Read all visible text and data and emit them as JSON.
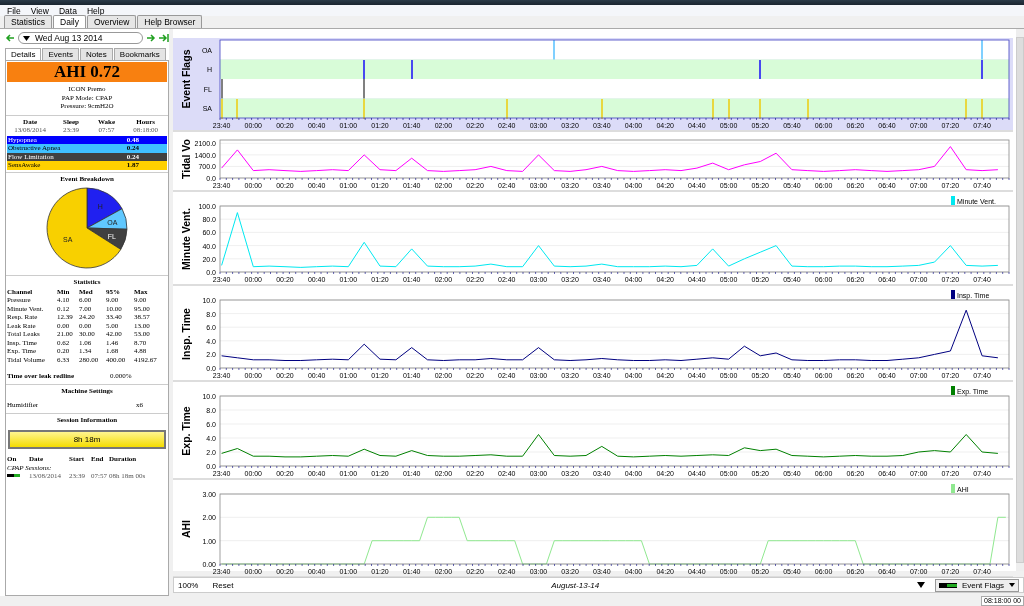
{
  "menu": [
    {
      "label": "File"
    },
    {
      "label": "View"
    },
    {
      "label": "Data"
    },
    {
      "label": "Help"
    }
  ],
  "tabs": [
    {
      "label": "Statistics",
      "selected": false
    },
    {
      "label": "Daily",
      "selected": true
    },
    {
      "label": "Overview",
      "selected": false
    },
    {
      "label": "Help Browser",
      "selected": false
    }
  ],
  "date_picker": {
    "value": "Wed Aug 13 2014"
  },
  "side_tabs": [
    {
      "label": "Details",
      "selected": true
    },
    {
      "label": "Events",
      "selected": false
    },
    {
      "label": "Notes",
      "selected": false
    },
    {
      "label": "Bookmarks",
      "selected": false
    }
  ],
  "ahi_banner": "AHI 0.72",
  "device_info": [
    "ICON Premo",
    "PAP Mode: CPAP",
    "Pressure: 9cmH2O"
  ],
  "summary": {
    "columns": [
      "Date",
      "Sleep",
      "Wake",
      "Hours"
    ],
    "row": [
      "13/08/2014",
      "23:39",
      "07:57",
      "08:18:00"
    ]
  },
  "event_indices": [
    {
      "name": "Hypopnea",
      "value": "0.48",
      "color": "#0000ff"
    },
    {
      "name": "Obstructive Apnea",
      "value": "0.24",
      "color": "#40c0ff"
    },
    {
      "name": "Flow Limitation",
      "value": "0.24",
      "color": "#404040"
    },
    {
      "name": "SensAwake",
      "value": "1.87",
      "color": "#ffd000"
    }
  ],
  "event_breakdown": {
    "title": "Event Breakdown",
    "chart_data": {
      "type": "pie",
      "categories": [
        "H",
        "OA",
        "FL",
        "SA"
      ],
      "values": [
        17.0,
        8.5,
        8.5,
        66.0
      ],
      "colors": [
        "#2020f0",
        "#60c8ff",
        "#404040",
        "#f8d000"
      ]
    }
  },
  "statistics": {
    "title": "Statistics",
    "columns": [
      "Channel",
      "Min",
      "Med",
      "95%",
      "Max"
    ],
    "rows": [
      [
        "Pressure",
        "4.10",
        "6.00",
        "9.00",
        "9.00"
      ],
      [
        "Minute Vent.",
        "0.12",
        "7.00",
        "10.00",
        "95.00"
      ],
      [
        "Resp. Rate",
        "12.39",
        "24.20",
        "33.40",
        "38.57"
      ],
      [
        "Leak Rate",
        "0.00",
        "0.00",
        "5.00",
        "13.00"
      ],
      [
        "Total Leaks",
        "21.00",
        "30.00",
        "42.00",
        "53.00"
      ],
      [
        "Insp. Time",
        "0.62",
        "1.06",
        "1.46",
        "8.70"
      ],
      [
        "Exp. Time",
        "0.20",
        "1.34",
        "1.68",
        "4.88"
      ],
      [
        "Tidal Volume",
        "6.33",
        "280.00",
        "400.00",
        "4192.67"
      ]
    ]
  },
  "leak_redline": {
    "label": "Time over leak redline",
    "value": "0.000%"
  },
  "machine_settings": {
    "title": "Machine Settings",
    "rows": [
      {
        "name": "Humidifier",
        "value": "x6"
      }
    ]
  },
  "session_info": {
    "title": "Session Information",
    "total": "8h 18m",
    "columns": [
      "On",
      "Date",
      "Start",
      "End",
      "Duration"
    ],
    "group": "CPAP Sessions:",
    "sessions": [
      {
        "on": true,
        "date": "13/08/2014",
        "start": "23:39",
        "end": "07:57",
        "duration": "08h 18m 00s"
      }
    ]
  },
  "event_flags": {
    "title": "Event Flags",
    "time_labels": [
      "23:40",
      "00:00",
      "00:20",
      "00:40",
      "01:00",
      "01:20",
      "01:40",
      "02:00",
      "02:20",
      "02:40",
      "03:00",
      "03:20",
      "03:40",
      "04:00",
      "04:20",
      "04:40",
      "05:00",
      "05:20",
      "05:40",
      "06:00",
      "06:20",
      "06:40",
      "07:00",
      "07:20",
      "07:40"
    ],
    "rows": [
      {
        "label": "OA",
        "color": "#80d0ff",
        "marks": [
          false,
          false,
          false,
          false,
          false,
          false,
          false,
          false,
          false,
          false,
          false,
          false,
          false,
          false,
          false,
          false,
          false,
          false,
          false,
          false,
          false,
          true,
          false,
          false,
          false,
          false,
          false,
          false,
          false,
          false,
          false,
          false,
          false,
          false,
          false,
          false,
          false,
          false,
          false,
          false,
          false,
          false,
          false,
          false,
          false,
          false,
          false,
          false,
          true,
          false
        ]
      },
      {
        "label": "H",
        "color": "#4848f0",
        "marks": [
          false,
          false,
          false,
          false,
          false,
          false,
          false,
          false,
          false,
          true,
          false,
          false,
          true,
          false,
          false,
          false,
          false,
          false,
          false,
          false,
          false,
          false,
          false,
          false,
          false,
          false,
          false,
          false,
          false,
          false,
          false,
          false,
          false,
          false,
          true,
          false,
          false,
          false,
          false,
          false,
          false,
          false,
          false,
          false,
          false,
          false,
          false,
          false,
          true,
          false
        ]
      },
      {
        "label": "FL",
        "color": "#808080",
        "marks": [
          true,
          false,
          false,
          false,
          false,
          false,
          false,
          false,
          false,
          true,
          false,
          false,
          false,
          false,
          false,
          false,
          false,
          false,
          false,
          false,
          false,
          false,
          false,
          false,
          false,
          false,
          false,
          false,
          false,
          false,
          false,
          false,
          false,
          false,
          false,
          false,
          false,
          false,
          false,
          false,
          false,
          false,
          false,
          false,
          false,
          false,
          false,
          false,
          false,
          false
        ]
      },
      {
        "label": "SA",
        "color": "#e8d840",
        "marks": [
          true,
          true,
          false,
          false,
          false,
          false,
          false,
          false,
          false,
          true,
          false,
          false,
          false,
          false,
          false,
          false,
          false,
          false,
          true,
          false,
          false,
          false,
          false,
          false,
          true,
          false,
          false,
          false,
          false,
          false,
          false,
          true,
          true,
          false,
          true,
          false,
          false,
          true,
          false,
          false,
          false,
          false,
          false,
          false,
          false,
          false,
          false,
          true,
          true,
          false
        ]
      }
    ]
  },
  "charts": [
    {
      "title": "Tidal Vo",
      "chart_data": {
        "type": "line",
        "grid": true,
        "categories": [
          "23:40",
          null,
          "00:00",
          null,
          "00:20",
          null,
          "00:40",
          null,
          "01:00",
          null,
          "01:20",
          null,
          "01:40",
          null,
          "02:00",
          null,
          "02:20",
          null,
          "02:40",
          null,
          "03:00",
          null,
          "03:20",
          null,
          "03:40",
          null,
          "04:00",
          null,
          "04:20",
          null,
          "04:40",
          null,
          "05:00",
          null,
          "05:20",
          null,
          "05:40",
          null,
          "06:00",
          null,
          "06:20",
          null,
          "06:40",
          null,
          "07:00",
          null,
          "07:20",
          null,
          "07:40",
          null
        ],
        "series": [
          {
            "color": "#ff00ff",
            "values": [
              600,
              1700,
              450,
              500,
              450,
              400,
              450,
              500,
              450,
              1400,
              500,
              450,
              1200,
              450,
              400,
              450,
              500,
              700,
              450,
              400,
              1400,
              450,
              400,
              500,
              700,
              450,
              400,
              450,
              500,
              450,
              600,
              900,
              500,
              800,
              1000,
              1500,
              500,
              450,
              400,
              450,
              500,
              450,
              400,
              450,
              500,
              700,
              1900,
              500,
              450,
              500
            ]
          }
        ],
        "ylim": [
          0,
          2300
        ],
        "yticks": [
          {
            "value": 0,
            "label": "0.0"
          },
          {
            "value": 700,
            "label": "700.0"
          },
          {
            "value": 1400,
            "label": "1400.0"
          },
          {
            "value": 2100,
            "label": "2100.0"
          }
        ]
      }
    },
    {
      "title": "Minute Vent.",
      "chart_data": {
        "type": "line",
        "grid": true,
        "categories": [
          "23:40",
          null,
          "00:00",
          null,
          "00:20",
          null,
          "00:40",
          null,
          "01:00",
          null,
          "01:20",
          null,
          "01:40",
          null,
          "02:00",
          null,
          "02:20",
          null,
          "02:40",
          null,
          "03:00",
          null,
          "03:20",
          null,
          "03:40",
          null,
          "04:00",
          null,
          "04:20",
          null,
          "04:40",
          null,
          "05:00",
          null,
          "05:20",
          null,
          "05:40",
          null,
          "06:00",
          null,
          "06:20",
          null,
          "06:40",
          null,
          "07:00",
          null,
          "07:20",
          null,
          "07:40",
          null
        ],
        "series": [
          {
            "name": "Minute Vent.",
            "color": "#00e8f0",
            "values": [
              10,
              90,
              8,
              9,
              8,
              7,
              8,
              9,
              8,
              45,
              9,
              8,
              35,
              9,
              8,
              8,
              9,
              12,
              8,
              8,
              40,
              9,
              8,
              9,
              12,
              8,
              8,
              8,
              9,
              8,
              10,
              35,
              9,
              20,
              30,
              40,
              9,
              8,
              8,
              9,
              9,
              8,
              8,
              9,
              10,
              15,
              40,
              10,
              9,
              10
            ]
          }
        ],
        "ylim": [
          0,
          100
        ],
        "yticks": [
          {
            "value": 0,
            "label": "0.0"
          },
          {
            "value": 20,
            "label": "20.0"
          },
          {
            "value": 40,
            "label": "40.0"
          },
          {
            "value": 60,
            "label": "60.0"
          },
          {
            "value": 80,
            "label": "80.0"
          },
          {
            "value": 100,
            "label": "100.0"
          }
        ]
      }
    },
    {
      "title": "Insp. Time",
      "chart_data": {
        "type": "line",
        "grid": true,
        "categories": [
          "23:40",
          null,
          "00:00",
          null,
          "00:20",
          null,
          "00:40",
          null,
          "01:00",
          null,
          "01:20",
          null,
          "01:40",
          null,
          "02:00",
          null,
          "02:20",
          null,
          "02:40",
          null,
          "03:00",
          null,
          "03:20",
          null,
          "03:40",
          null,
          "04:00",
          null,
          "04:20",
          null,
          "04:40",
          null,
          "05:00",
          null,
          "05:20",
          null,
          "05:40",
          null,
          "06:00",
          null,
          "06:20",
          null,
          "06:40",
          null,
          "07:00",
          null,
          "07:20",
          null,
          "07:40",
          null
        ],
        "series": [
          {
            "name": "Insp. Time",
            "color": "#000080",
            "values": [
              1.8,
              1.5,
              1.2,
              1.2,
              1.1,
              1.1,
              1.2,
              1.3,
              1.2,
              3.5,
              1.3,
              1.2,
              3.0,
              1.2,
              1.1,
              1.2,
              1.2,
              1.4,
              1.2,
              1.2,
              3.0,
              1.2,
              1.1,
              1.2,
              1.4,
              1.2,
              1.1,
              1.1,
              1.2,
              1.1,
              1.3,
              1.5,
              1.3,
              3.2,
              1.8,
              2.2,
              1.2,
              1.1,
              1.1,
              1.2,
              1.2,
              1.1,
              1.1,
              1.3,
              1.5,
              2.0,
              2.5,
              8.5,
              1.8,
              1.5
            ]
          }
        ],
        "ylim": [
          0,
          10
        ],
        "yticks": [
          {
            "value": 0,
            "label": "0.0"
          },
          {
            "value": 2,
            "label": "2.0"
          },
          {
            "value": 4,
            "label": "4.0"
          },
          {
            "value": 6,
            "label": "6.0"
          },
          {
            "value": 8,
            "label": "8.0"
          },
          {
            "value": 10,
            "label": "10.0"
          }
        ]
      }
    },
    {
      "title": "Exp. Time",
      "chart_data": {
        "type": "line",
        "grid": true,
        "categories": [
          "23:40",
          null,
          "00:00",
          null,
          "00:20",
          null,
          "00:40",
          null,
          "01:00",
          null,
          "01:20",
          null,
          "01:40",
          null,
          "02:00",
          null,
          "02:20",
          null,
          "02:40",
          null,
          "03:00",
          null,
          "03:20",
          null,
          "03:40",
          null,
          "04:00",
          null,
          "04:20",
          null,
          "04:40",
          null,
          "05:00",
          null,
          "05:20",
          null,
          "05:40",
          null,
          "06:00",
          null,
          "06:20",
          null,
          "06:40",
          null,
          "07:00",
          null,
          "07:20",
          null,
          "07:40",
          null
        ],
        "series": [
          {
            "name": "Exp. Time",
            "color": "#008000",
            "values": [
              1.8,
              2.5,
              1.4,
              1.4,
              1.3,
              1.3,
              1.4,
              1.5,
              1.4,
              2.4,
              1.5,
              1.4,
              2.2,
              1.5,
              1.4,
              1.4,
              1.5,
              1.6,
              1.4,
              1.4,
              4.5,
              1.5,
              1.4,
              1.5,
              2.8,
              1.4,
              1.3,
              1.4,
              1.5,
              1.4,
              1.5,
              1.6,
              1.5,
              2.6,
              2.2,
              2.4,
              1.5,
              1.4,
              1.3,
              1.4,
              1.5,
              1.4,
              1.4,
              1.5,
              2.0,
              2.2,
              2.0,
              4.5,
              2.0,
              1.8
            ]
          }
        ],
        "ylim": [
          0,
          10
        ],
        "yticks": [
          {
            "value": 0,
            "label": "0.0"
          },
          {
            "value": 2,
            "label": "2.0"
          },
          {
            "value": 4,
            "label": "4.0"
          },
          {
            "value": 6,
            "label": "6.0"
          },
          {
            "value": 8,
            "label": "8.0"
          },
          {
            "value": 10,
            "label": "10.0"
          }
        ]
      }
    },
    {
      "title": "AHI",
      "chart_data": {
        "type": "line",
        "grid": true,
        "categories": [
          "23:40",
          null,
          null,
          null,
          "00:00",
          null,
          null,
          null,
          "00:20",
          null,
          null,
          null,
          "00:40",
          null,
          null,
          null,
          "01:00",
          null,
          null,
          null,
          "01:20",
          null,
          null,
          null,
          "01:40",
          null,
          null,
          null,
          "02:00",
          null,
          null,
          null,
          "02:20",
          null,
          null,
          null,
          "02:40",
          null,
          null,
          null,
          "03:00",
          null,
          null,
          null,
          "03:20",
          null,
          null,
          null,
          "03:40",
          null,
          null,
          null,
          "04:00",
          null,
          null,
          null,
          "04:20",
          null,
          null,
          null,
          "04:40",
          null,
          null,
          null,
          "05:00",
          null,
          null,
          null,
          "05:20",
          null,
          null,
          null,
          "05:40",
          null,
          null,
          null,
          "06:00",
          null,
          null,
          null,
          "06:20",
          null,
          null,
          null,
          "06:40",
          null,
          null,
          null,
          "07:00",
          null,
          null,
          null,
          "07:20",
          null,
          null,
          null,
          "07:40",
          null,
          null,
          null
        ],
        "series": [
          {
            "name": "AHI",
            "color": "#90e890",
            "values": [
              0,
              0,
              0,
              0,
              0,
              0,
              0,
              0,
              0,
              0,
              0,
              0,
              0,
              0,
              0,
              0,
              0,
              0,
              0,
              1,
              1,
              1,
              1,
              1,
              1,
              1,
              2,
              2,
              2,
              2,
              2,
              1,
              1,
              1,
              1,
              1,
              1,
              1,
              0,
              0,
              0,
              0,
              1,
              1,
              1,
              1,
              1,
              1,
              1,
              1,
              1,
              1,
              1,
              1,
              0,
              0,
              0,
              0,
              0,
              0,
              0,
              0,
              0,
              0,
              0,
              0,
              0,
              0,
              0,
              1,
              1,
              1,
              1,
              1,
              1,
              1,
              1,
              1,
              1,
              1,
              1,
              0,
              0,
              0,
              0,
              0,
              0,
              0,
              0,
              0,
              0,
              0,
              0,
              0,
              0,
              0,
              0,
              0,
              2,
              2
            ]
          }
        ],
        "ylim": [
          0,
          3
        ],
        "yticks": [
          {
            "value": 0,
            "label": "0.00"
          },
          {
            "value": 1,
            "label": "1.00"
          },
          {
            "value": 2,
            "label": "2.00"
          },
          {
            "value": 3,
            "label": "3.00"
          }
        ]
      }
    }
  ],
  "footer": {
    "zoom": "100%",
    "reset": "Reset",
    "date": "August-13-14",
    "dropdown": "Event Flags"
  },
  "status_bar": "08:18:00 00"
}
